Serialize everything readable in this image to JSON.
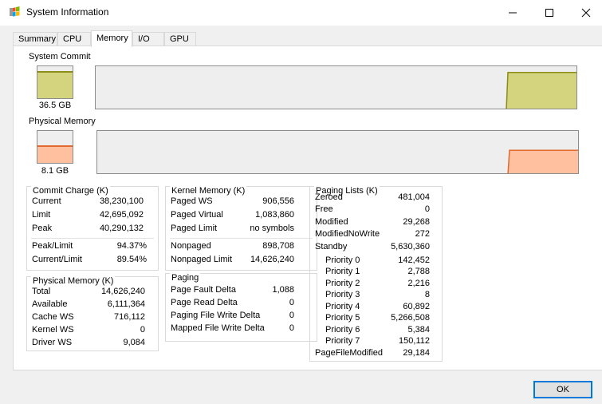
{
  "window": {
    "title": "System Information",
    "app_icon": "windows-flag-icon"
  },
  "tabs": [
    {
      "label": "Summary",
      "active": false
    },
    {
      "label": "CPU",
      "active": false
    },
    {
      "label": "Memory",
      "active": true
    },
    {
      "label": "I/O",
      "active": false
    },
    {
      "label": "GPU",
      "active": false
    }
  ],
  "system_commit": {
    "label": "System Commit",
    "value": "36.5 GB",
    "meter_level": 0.86,
    "graph_level": 0.86,
    "color_fill": "#d4d47e",
    "color_line": "#8c8c1a"
  },
  "physical_memory_graph": {
    "label": "Physical Memory",
    "value": "8.1 GB",
    "meter_level": 0.56,
    "graph_level": 0.56,
    "color_fill": "#ffc0a0",
    "color_line": "#e06a30"
  },
  "commit_charge": {
    "title": "Commit Charge (K)",
    "rows": [
      {
        "k": "Current",
        "v": "38,230,100"
      },
      {
        "k": "Limit",
        "v": "42,695,092"
      },
      {
        "k": "Peak",
        "v": "40,290,132"
      }
    ],
    "rows2": [
      {
        "k": "Peak/Limit",
        "v": "94.37%"
      },
      {
        "k": "Current/Limit",
        "v": "89.54%"
      }
    ]
  },
  "physical_memory": {
    "title": "Physical Memory (K)",
    "rows": [
      {
        "k": "Total",
        "v": "14,626,240"
      },
      {
        "k": "Available",
        "v": "6,111,364"
      },
      {
        "k": "Cache WS",
        "v": "716,112"
      },
      {
        "k": "Kernel WS",
        "v": "0"
      },
      {
        "k": "Driver WS",
        "v": "9,084"
      }
    ]
  },
  "kernel_memory": {
    "title": "Kernel Memory (K)",
    "rows": [
      {
        "k": "Paged WS",
        "v": "906,556"
      },
      {
        "k": "Paged Virtual",
        "v": "1,083,860"
      },
      {
        "k": "Paged Limit",
        "v": "no symbols"
      }
    ],
    "rows2": [
      {
        "k": "Nonpaged",
        "v": "898,708"
      },
      {
        "k": "Nonpaged Limit",
        "v": "14,626,240"
      }
    ]
  },
  "paging": {
    "title": "Paging",
    "rows": [
      {
        "k": "Page Fault Delta",
        "v": "1,088"
      },
      {
        "k": "Page Read Delta",
        "v": "0"
      },
      {
        "k": "Paging File Write Delta",
        "v": "0"
      },
      {
        "k": "Mapped File Write Delta",
        "v": "0"
      }
    ]
  },
  "paging_lists": {
    "title": "Paging Lists (K)",
    "rows": [
      {
        "k": "Zeroed",
        "v": "481,004"
      },
      {
        "k": "Free",
        "v": "0"
      },
      {
        "k": "Modified",
        "v": "29,268"
      },
      {
        "k": "ModifiedNoWrite",
        "v": "272"
      },
      {
        "k": "Standby",
        "v": "5,630,360"
      }
    ],
    "priorities": [
      {
        "k": "Priority 0",
        "v": "142,452"
      },
      {
        "k": "Priority 1",
        "v": "2,788"
      },
      {
        "k": "Priority 2",
        "v": "2,216"
      },
      {
        "k": "Priority 3",
        "v": "8"
      },
      {
        "k": "Priority 4",
        "v": "60,892"
      },
      {
        "k": "Priority 5",
        "v": "5,266,508"
      },
      {
        "k": "Priority 6",
        "v": "5,384"
      },
      {
        "k": "Priority 7",
        "v": "150,112"
      }
    ],
    "last": {
      "k": "PageFileModified",
      "v": "29,184"
    }
  },
  "buttons": {
    "ok_label": "OK"
  }
}
